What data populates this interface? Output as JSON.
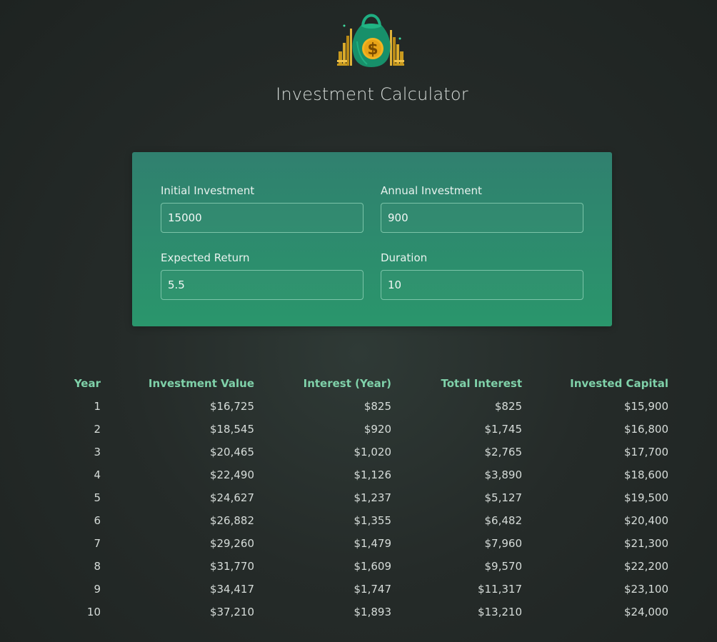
{
  "header": {
    "logo_icon": "money-bag-icon",
    "title": "Investment Calculator"
  },
  "inputs": {
    "initial_investment": {
      "label": "Initial Investment",
      "value": "15000"
    },
    "annual_investment": {
      "label": "Annual Investment",
      "value": "900"
    },
    "expected_return": {
      "label": "Expected Return",
      "value": "5.5"
    },
    "duration": {
      "label": "Duration",
      "value": "10"
    }
  },
  "table": {
    "headers": [
      "Year",
      "Investment Value",
      "Interest (Year)",
      "Total Interest",
      "Invested Capital"
    ],
    "rows": [
      [
        "1",
        "$16,725",
        "$825",
        "$825",
        "$15,900"
      ],
      [
        "2",
        "$18,545",
        "$920",
        "$1,745",
        "$16,800"
      ],
      [
        "3",
        "$20,465",
        "$1,020",
        "$2,765",
        "$17,700"
      ],
      [
        "4",
        "$22,490",
        "$1,126",
        "$3,890",
        "$18,600"
      ],
      [
        "5",
        "$24,627",
        "$1,237",
        "$5,127",
        "$19,500"
      ],
      [
        "6",
        "$26,882",
        "$1,355",
        "$6,482",
        "$20,400"
      ],
      [
        "7",
        "$29,260",
        "$1,479",
        "$7,960",
        "$21,300"
      ],
      [
        "8",
        "$31,770",
        "$1,609",
        "$9,570",
        "$22,200"
      ],
      [
        "9",
        "$34,417",
        "$1,747",
        "$11,317",
        "$23,100"
      ],
      [
        "10",
        "$37,210",
        "$1,893",
        "$13,210",
        "$24,000"
      ]
    ]
  },
  "colors": {
    "accent": "#7fd1a9",
    "card_top": "#30806f",
    "card_bottom": "#2a966c",
    "background": "#252b29"
  }
}
